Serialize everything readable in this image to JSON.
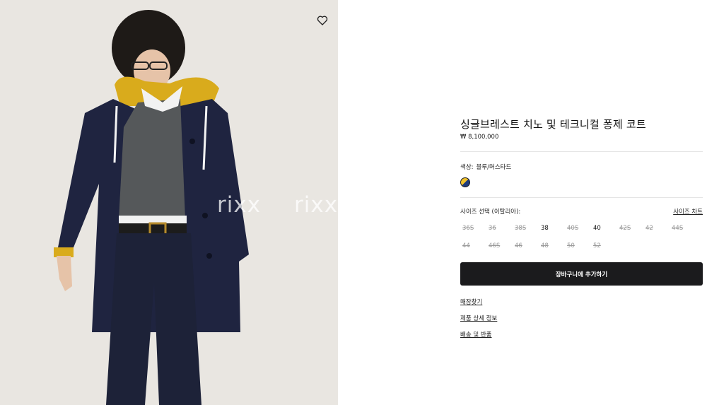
{
  "watermark": {
    "text_1": "rixx",
    "text_2": "rixx"
  },
  "product": {
    "title": "싱글브레스트 치노 및 테크니컬 퐁제 코트",
    "price": "₩ 8,100,000",
    "color_label": "색상:",
    "color_value": "블루/머스타드",
    "swatch_colors": [
      "#f0c12a",
      "#1d3b7d"
    ]
  },
  "size": {
    "label": "사이즈 선택 (이탈리아):",
    "chart_link": "사이즈 차트",
    "options": [
      {
        "label": "36S",
        "available": false
      },
      {
        "label": "36",
        "available": false
      },
      {
        "label": "38S",
        "available": false
      },
      {
        "label": "38",
        "available": true
      },
      {
        "label": "40S",
        "available": false
      },
      {
        "label": "40",
        "available": true
      },
      {
        "label": "42S",
        "available": false
      },
      {
        "label": "42",
        "available": false
      },
      {
        "label": "44S",
        "available": false
      },
      {
        "label": "44",
        "available": false
      },
      {
        "label": "46S",
        "available": false
      },
      {
        "label": "46",
        "available": false
      },
      {
        "label": "48",
        "available": false
      },
      {
        "label": "50",
        "available": false
      },
      {
        "label": "52",
        "available": false
      }
    ]
  },
  "actions": {
    "add_to_cart": "장바구니에 추가하기",
    "store_finder": "매장찾기",
    "product_details": "제품 상세 정보",
    "shipping_returns": "배송 및 반품"
  }
}
